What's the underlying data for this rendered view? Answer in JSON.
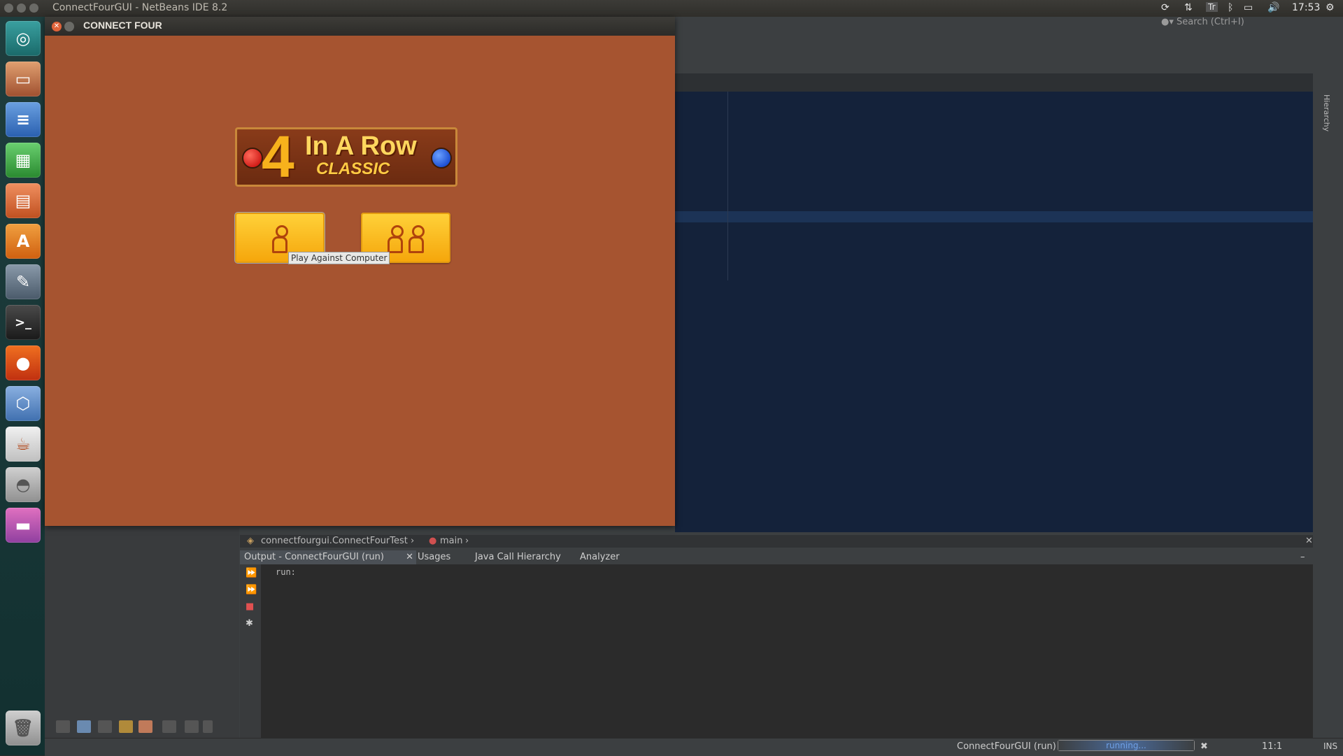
{
  "top_panel": {
    "app_title": "ConnectFourGUI - NetBeans IDE 8.2",
    "time": "17:53",
    "keyboard_indicator": "Tr"
  },
  "search": {
    "placeholder": "Search (Ctrl+I)"
  },
  "launcher": {
    "icons": [
      "ubuntu-dash-icon",
      "files-icon",
      "writer-icon",
      "calc-icon",
      "impress-icon",
      "software-center-icon",
      "system-settings-icon",
      "terminal-icon",
      "firefox-icon",
      "virtualbox-icon",
      "java-icon",
      "disk-icon",
      "app-window-icon",
      "trash-icon"
    ]
  },
  "game_window": {
    "title": "CONNECT FOUR",
    "logo": {
      "four": "4",
      "in_a_row": "In A Row",
      "classic": "CLASSIC"
    },
    "tooltip": "Play Against Computer"
  },
  "breadcrumb": {
    "class_path": "connectfourgui.ConnectFourTest",
    "method": "main"
  },
  "output": {
    "tabs": [
      "Output - ConnectFourGUI (run)",
      "Usages",
      "Java Call Hierarchy",
      "Analyzer"
    ],
    "text": "run:"
  },
  "status_bar": {
    "task": "ConnectFourGUI (run)",
    "progress_text": "running...",
    "position": "11:1",
    "mode": "INS"
  },
  "right_panel": {
    "label": "Hierarchy"
  }
}
